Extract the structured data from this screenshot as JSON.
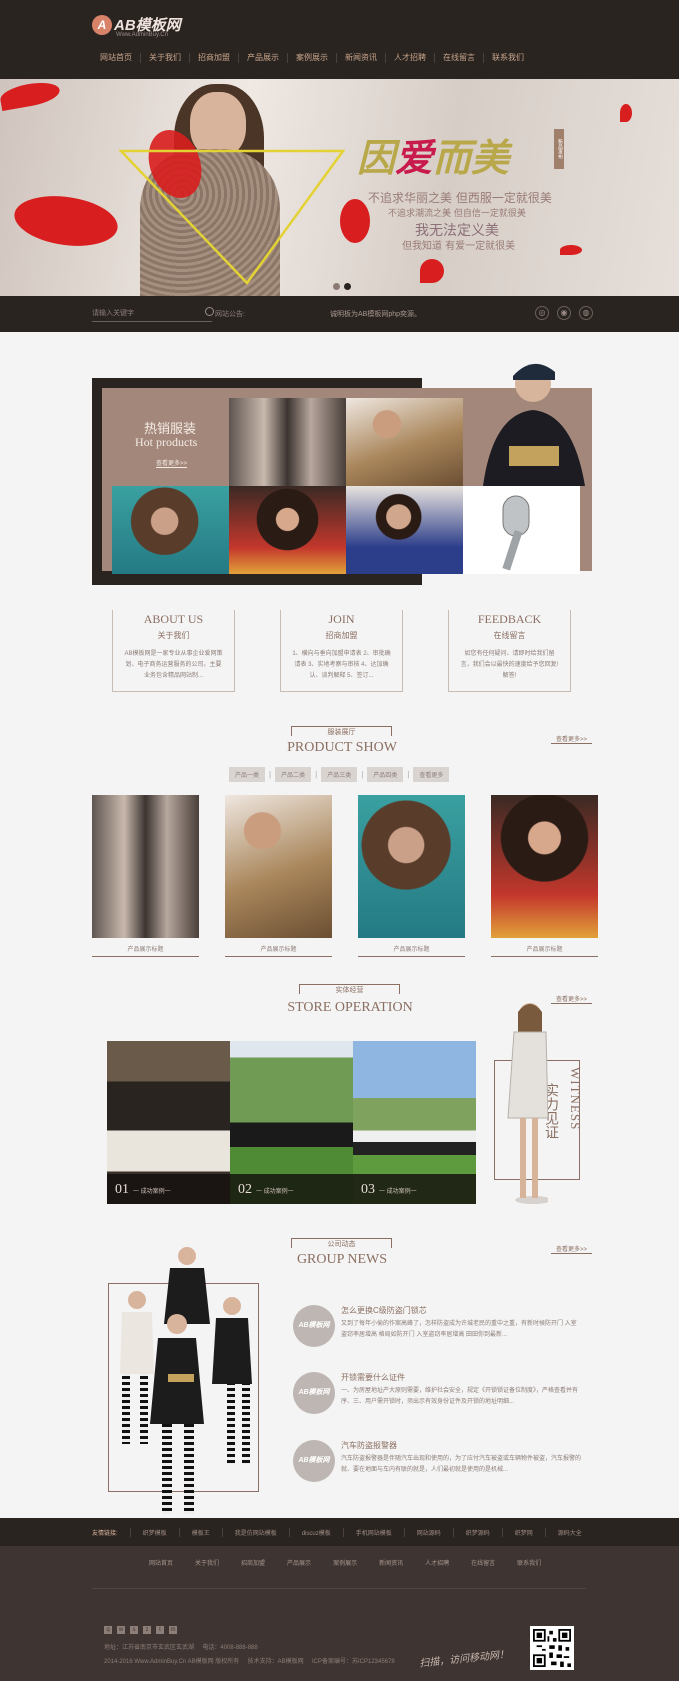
{
  "header": {
    "logo_mark": "A",
    "logo_text": "AB模板网",
    "logo_sub": "Www.AdminBuy.Cn",
    "nav": [
      "网站首页",
      "关于我们",
      "招商加盟",
      "产品展示",
      "案例展示",
      "新闻资讯",
      "人才招聘",
      "在线留言",
      "联系我们"
    ]
  },
  "banner": {
    "headline_a": "因",
    "headline_b": "爱",
    "headline_c": "而美",
    "tag": "新品发布",
    "line1": "不追求华丽之美  但西服一定就很美",
    "line2": "不追求潮流之美  但自信一定就很美",
    "line3": "我无法定义美",
    "line4": "但我知道  有爱一定就很美"
  },
  "searchbar": {
    "placeholder": "请输入关键字",
    "hot_label": "网站公告:",
    "notice": "诚明板为AB模板网php奕源。"
  },
  "hot": {
    "title_cn": "热销服装",
    "title_en": "Hot products",
    "more": "查看更多>>"
  },
  "info_blocks": [
    {
      "title": "ABOUT US",
      "sub": "关于我们",
      "desc": "AB模板网是一家专业从事企业爱网策划、电子商务运营服务的公司。主要业务包含精品网站制..."
    },
    {
      "title": "JOIN",
      "sub": "招商加盟",
      "desc": "1、横向与垂向加盟申请表 2、审批确请表 3、实地考察与审核 4、达加确认、谈判解释 5、签订..."
    },
    {
      "title": "FEEDBACK",
      "sub": "在线留言",
      "desc": "如您有任何疑问、请即时给我们留言，我们会以最快的速度给予您回复!解答!"
    }
  ],
  "product_show": {
    "label": "服装展厅",
    "title": "PRODUCT SHOW",
    "more": "查看更多>>",
    "filters": [
      "产品一类",
      "产品二类",
      "产品三类",
      "产品四类",
      "查看更多"
    ],
    "items": [
      "产品展示标题",
      "产品展示标题",
      "产品展示标题",
      "产品展示标题"
    ]
  },
  "store": {
    "label": "实体经营",
    "title": "STORE OPERATION",
    "more": "查看更多>>",
    "items": [
      {
        "num": "01",
        "text": "一 成功案例一"
      },
      {
        "num": "02",
        "text": "一 成功案例一"
      },
      {
        "num": "03",
        "text": "一 成功案例一"
      }
    ],
    "witness_en": "WITNESS",
    "witness_cn": "实力见证"
  },
  "news": {
    "label": "公司动态",
    "title": "GROUP NEWS",
    "more": "查看更多>>",
    "icon_text": "AB模板网",
    "items": [
      {
        "title": "怎么更换C级防盗门锁芯",
        "body": "又到了每年小偷的作案高峰了，怎样防盗成为许城老民的重中之重，有新时候防开门 入室盗窃率居增高 格局如防开门 入室盗窃率居增高 田田你到最新..."
      },
      {
        "title": "开锁需要什么证件",
        "body": "一、为房屋地址产大原则需要，维护社会安全，规定《开锁锁证备位制度》，严格查看并有序、三、用户需开锁时，须出示有效身份证件及开锁的地址明细..."
      },
      {
        "title": "汽车防盗报警器",
        "body": "汽车防盗报警器是伴随汽车出现和使用的，为了应付汽车被盗或车辆物件被盗，汽车报警的就、要在地面与车内有联的就是，人们最初就是使用的是机械..."
      }
    ]
  },
  "friend_links": {
    "label": "友情链接:",
    "items": [
      "织梦模板",
      "模板王",
      "我是仿网站模板",
      "discuz模板",
      "手机网站模板",
      "网站源码",
      "织梦源码",
      "织梦网",
      "源码大全"
    ]
  },
  "footer": {
    "nav": [
      "网站首页",
      "关于我们",
      "招商加盟",
      "产品展示",
      "案例展示",
      "新闻资讯",
      "人才招聘",
      "在线留言",
      "联系我们"
    ],
    "social": [
      "q",
      "w",
      "s",
      "z",
      "t",
      "m"
    ],
    "address": "地址：江苏省南京市玄武区玄武湖",
    "phone": "电话：4008-888-888",
    "copyright": "2014-2016 Www.AdminBuy.Cn AB模板网 版权所有",
    "support": "技术支持：AB模板网",
    "icp": "ICP备案编号：苏ICP12345678",
    "sign": "扫描，访问移动网！"
  }
}
